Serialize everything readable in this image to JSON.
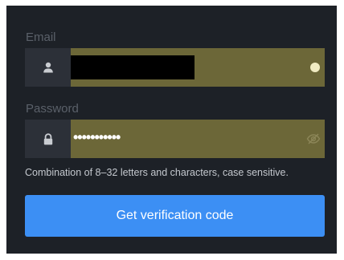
{
  "form": {
    "email": {
      "label": "Email",
      "icon": "user-icon",
      "value_redacted": true,
      "status_icon": "status-dot-icon"
    },
    "password": {
      "label": "Password",
      "icon": "lock-icon",
      "masked_value": "•••••••••••",
      "toggle_icon": "eye-off-icon"
    },
    "hint": "Combination of 8–32 letters and characters, case sensitive.",
    "submit_label": "Get verification code"
  },
  "colors": {
    "background": "#1d2127",
    "label": "#5a6069",
    "prefix_bg": "#2c3038",
    "autofill_bg": "#6c6738",
    "button": "#3c8ff4",
    "hint_text": "#c4c8ce"
  }
}
